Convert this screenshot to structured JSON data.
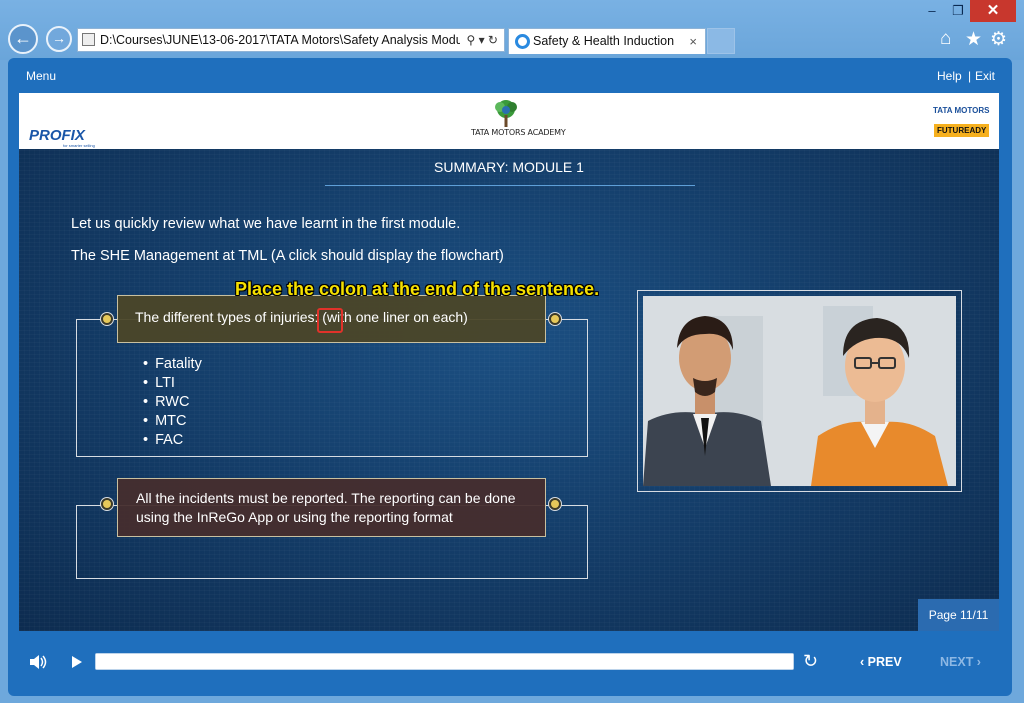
{
  "browser": {
    "address": "D:\\Courses\\JUNE\\13-06-2017\\TATA Motors\\Safety Analysis Modu",
    "tab_title": "Safety & Health Induction",
    "tab_close": "×",
    "addr_tools": "⚲ ▾ ↻",
    "win_min": "–",
    "win_max": "❐",
    "win_close": "✕",
    "back_glyph": "←",
    "fwd_glyph": "→",
    "home_glyph": "⌂",
    "star_glyph": "★",
    "gear_glyph": "⚙"
  },
  "player": {
    "menu": "Menu",
    "help": "Help",
    "divider": "|",
    "exit": "Exit"
  },
  "logos": {
    "profix": "PROFIX",
    "profix_tag": "for smarter selling",
    "academy": "TATA MOTORS ACADEMY",
    "tata_motors": "TATA MOTORS",
    "futuready": "FUTUREADY"
  },
  "slide": {
    "title": "SUMMARY: MODULE 1",
    "intro_1": "Let us quickly review what we have learnt in the first module.",
    "intro_2": "The SHE Management at TML (A click should display the flowchart)",
    "review_note": "Place the colon at the end of the sentence.",
    "box1_header": "The different types of injuries: (with one liner on each)",
    "injuries": [
      "Fatality",
      "LTI",
      "RWC",
      "MTC",
      "FAC"
    ],
    "box2_header": "All the incidents must be reported. The reporting can be done using the InReGo App or using the reporting format",
    "page": "Page 11/11"
  },
  "controls": {
    "replay_glyph": "↻",
    "prev": "‹ PREV",
    "next": "NEXT ›",
    "progress": 1.0
  }
}
